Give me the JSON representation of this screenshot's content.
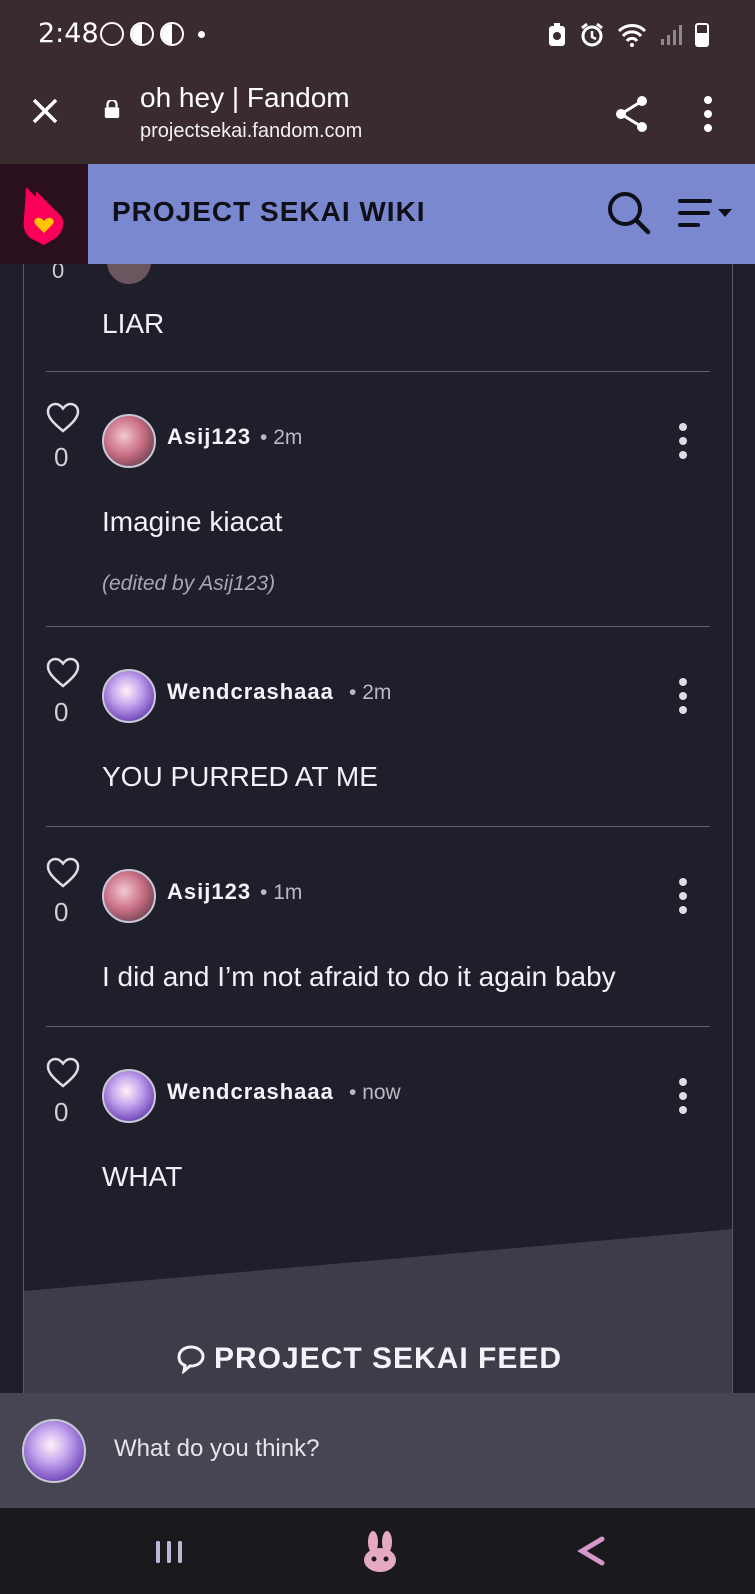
{
  "status_bar": {
    "time": "2:48"
  },
  "browser": {
    "page_title": "oh hey | Fandom",
    "domain": "projectsekai.fandom.com"
  },
  "wiki": {
    "name": "PROJECT SEKAI WIKI"
  },
  "top_cut_comment": {
    "text": "LIAR",
    "likes": "0"
  },
  "comments": [
    {
      "author": "Asij123",
      "time": "2m",
      "text": "Imagine kiacat",
      "likes": "0",
      "edited": "(edited by Asij123)"
    },
    {
      "author": "Wendcrashaaa",
      "time": "2m",
      "text": "YOU PURRED AT ME",
      "likes": "0"
    },
    {
      "author": "Asij123",
      "time": "1m",
      "text": "I did and I’m not afraid to do it again baby",
      "likes": "0"
    },
    {
      "author": "Wendcrashaaa",
      "time": "now",
      "text": "WHAT",
      "likes": "0"
    }
  ],
  "feed": {
    "title": "PROJECT SEKAI FEED"
  },
  "composer": {
    "placeholder": "What do you think?"
  },
  "colors": {
    "wiki_bar": "#7a88cf",
    "background": "#1f1f2b",
    "browser_bar": "#3a2b2e",
    "fandom_pink": "#fa005a",
    "fandom_yellow": "#ffc500"
  }
}
